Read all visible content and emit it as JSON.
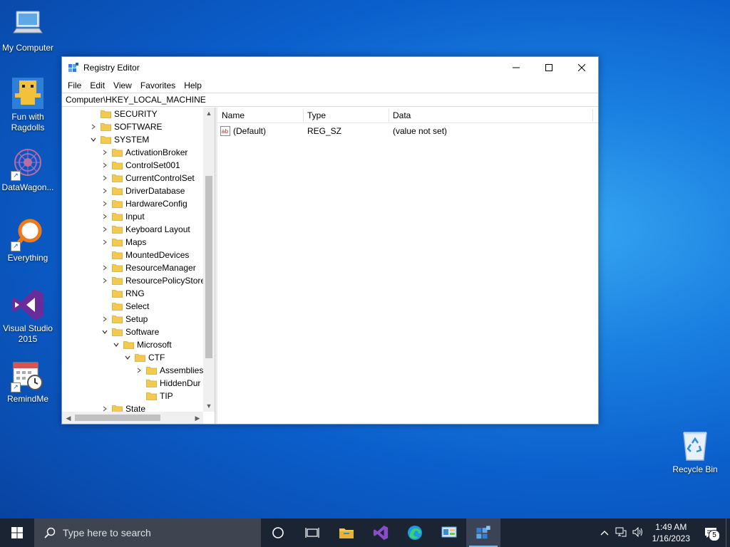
{
  "desktop": {
    "icons": [
      {
        "label": "My Computer"
      },
      {
        "label": "Fun with Ragdolls"
      },
      {
        "label": "DataWagon..."
      },
      {
        "label": "Everything"
      },
      {
        "label": "Visual Studio 2015"
      },
      {
        "label": "RemindMe"
      },
      {
        "label": "Recycle Bin"
      }
    ]
  },
  "window": {
    "title": "Registry Editor",
    "menu": [
      "File",
      "Edit",
      "View",
      "Favorites",
      "Help"
    ],
    "address": "Computer\\HKEY_LOCAL_MACHINE",
    "tree": [
      {
        "label": "SECURITY",
        "level": 0,
        "expander": "none"
      },
      {
        "label": "SOFTWARE",
        "level": 0,
        "expander": "collapsed"
      },
      {
        "label": "SYSTEM",
        "level": 0,
        "expander": "expanded"
      },
      {
        "label": "ActivationBroker",
        "level": 1,
        "expander": "collapsed"
      },
      {
        "label": "ControlSet001",
        "level": 1,
        "expander": "collapsed"
      },
      {
        "label": "CurrentControlSet",
        "level": 1,
        "expander": "collapsed"
      },
      {
        "label": "DriverDatabase",
        "level": 1,
        "expander": "collapsed"
      },
      {
        "label": "HardwareConfig",
        "level": 1,
        "expander": "collapsed"
      },
      {
        "label": "Input",
        "level": 1,
        "expander": "collapsed"
      },
      {
        "label": "Keyboard Layout",
        "level": 1,
        "expander": "collapsed"
      },
      {
        "label": "Maps",
        "level": 1,
        "expander": "collapsed"
      },
      {
        "label": "MountedDevices",
        "level": 1,
        "expander": "none"
      },
      {
        "label": "ResourceManager",
        "level": 1,
        "expander": "collapsed"
      },
      {
        "label": "ResourcePolicyStore",
        "level": 1,
        "expander": "collapsed"
      },
      {
        "label": "RNG",
        "level": 1,
        "expander": "none"
      },
      {
        "label": "Select",
        "level": 1,
        "expander": "none"
      },
      {
        "label": "Setup",
        "level": 1,
        "expander": "collapsed"
      },
      {
        "label": "Software",
        "level": 1,
        "expander": "expanded"
      },
      {
        "label": "Microsoft",
        "level": 2,
        "expander": "expanded"
      },
      {
        "label": "CTF",
        "level": 3,
        "expander": "expanded"
      },
      {
        "label": "Assemblies",
        "level": 4,
        "expander": "collapsed"
      },
      {
        "label": "HiddenDur",
        "level": 4,
        "expander": "none"
      },
      {
        "label": "TIP",
        "level": 4,
        "expander": "none"
      },
      {
        "label": "State",
        "level": 1,
        "expander": "collapsed"
      }
    ],
    "columns": {
      "name": "Name",
      "type": "Type",
      "data": "Data"
    },
    "values": [
      {
        "name": "(Default)",
        "type": "REG_SZ",
        "data": "(value not set)"
      }
    ]
  },
  "taskbar": {
    "search_placeholder": "Type here to search",
    "time": "1:49 AM",
    "date": "1/16/2023",
    "notification_count": "5"
  },
  "colors": {
    "folder": "#f3c94e",
    "accent": "#0078d7",
    "taskbar": "#1b2433"
  }
}
